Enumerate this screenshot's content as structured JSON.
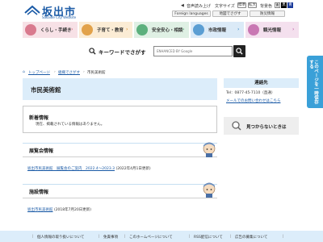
{
  "header": {
    "logo_name": "坂出市",
    "logo_sub": "Sakaide City Website",
    "read_aloud": "音声読み上げ",
    "font_size_label": "文字サイズ",
    "font_standard": "標準",
    "font_large": "拡大",
    "color_label": "背景色",
    "foreign_languages": "Foreign languages",
    "map": "地図でさがす",
    "disaster": "防災情報"
  },
  "nav": {
    "items": [
      {
        "label": "くらし・手続き",
        "color": "#d97a8e"
      },
      {
        "label": "子育て・教育",
        "color": "#e2a24a"
      },
      {
        "label": "安全安心・相談",
        "color": "#5cb07d"
      },
      {
        "label": "市政情報",
        "color": "#5b9ed3"
      },
      {
        "label": "観光情報",
        "color": "#c977b3"
      }
    ]
  },
  "search": {
    "label": "キーワードでさがす",
    "placeholder": "ENHANCED BY Google"
  },
  "side_tab": {
    "label": "このページを一時保存する"
  },
  "breadcrumb": {
    "home": "トップページ",
    "parent": "組織でさがす",
    "current": "市民美術館"
  },
  "page_title": "市民美術館",
  "news": {
    "heading": "新着情報",
    "body": "現在、掲載されている情報はありません。"
  },
  "contact": {
    "heading": "連絡先",
    "tel": "Tel：0877-45-7110（直通）",
    "mail": "メールでのお問い合わせはこちら"
  },
  "help": {
    "label": "見つからないときは"
  },
  "sections": [
    {
      "heading": "展覧会情報",
      "link": "坂出市民美術館　展覧会のご案内　2022.4～2023.3",
      "note": "(2022年4月1日更新)"
    },
    {
      "heading": "施設情報",
      "link": "坂出市民美術館",
      "note": "(2018年7月20日更新)"
    }
  ],
  "footer": {
    "links": [
      "個人情報の取り扱いについて",
      "免責事項",
      "このホームページについて",
      "RSS配信について",
      "広告の募集について"
    ]
  },
  "colors": {
    "brand": "#1a5aa6",
    "title_bg": "#dcedfa",
    "side_tab": "#3aa0d8"
  }
}
